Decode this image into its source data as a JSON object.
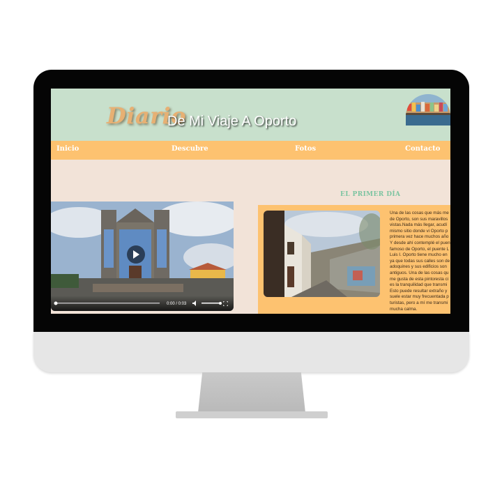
{
  "header": {
    "title_script": "Diario",
    "title_rest": "De Mi Viaje A Oporto"
  },
  "nav": {
    "items": [
      {
        "label": "Inicio"
      },
      {
        "label": "Descubre"
      },
      {
        "label": "Fotos"
      },
      {
        "label": "Contacto"
      }
    ]
  },
  "main": {
    "section_title": "EL PRIMER DÍA",
    "video": {
      "time": "0:00 / 0:03"
    },
    "article_text": "Una de las cosas que más me\nde Oporto, son sus maravillos\nvistas.Nada más llegar, acudí\nmismo sitio donde vi Oporto p\nprimera vez hace muchos año\nY desde ahí contemplé el puen\nfamoso de Oporto, el puente L\nLuis I. Oporto tiene mucho en\nya que todas sus calles son de\nadoquines y sus edificios son\nantiguos. Una de las cosas qu\nme gusta de esta pintoresta ci\nes la tranquilidad que transmi\nEsto puede resultar extraño y\nsuele estar muy frecuentada p\nturistas, pero a mí me transmi\nmucha calma."
  },
  "colors": {
    "header_bg": "#c8e0cc",
    "nav_bg": "#fdc270",
    "page_bg": "#f2e3d8",
    "accent_title": "#7cc4a1"
  }
}
